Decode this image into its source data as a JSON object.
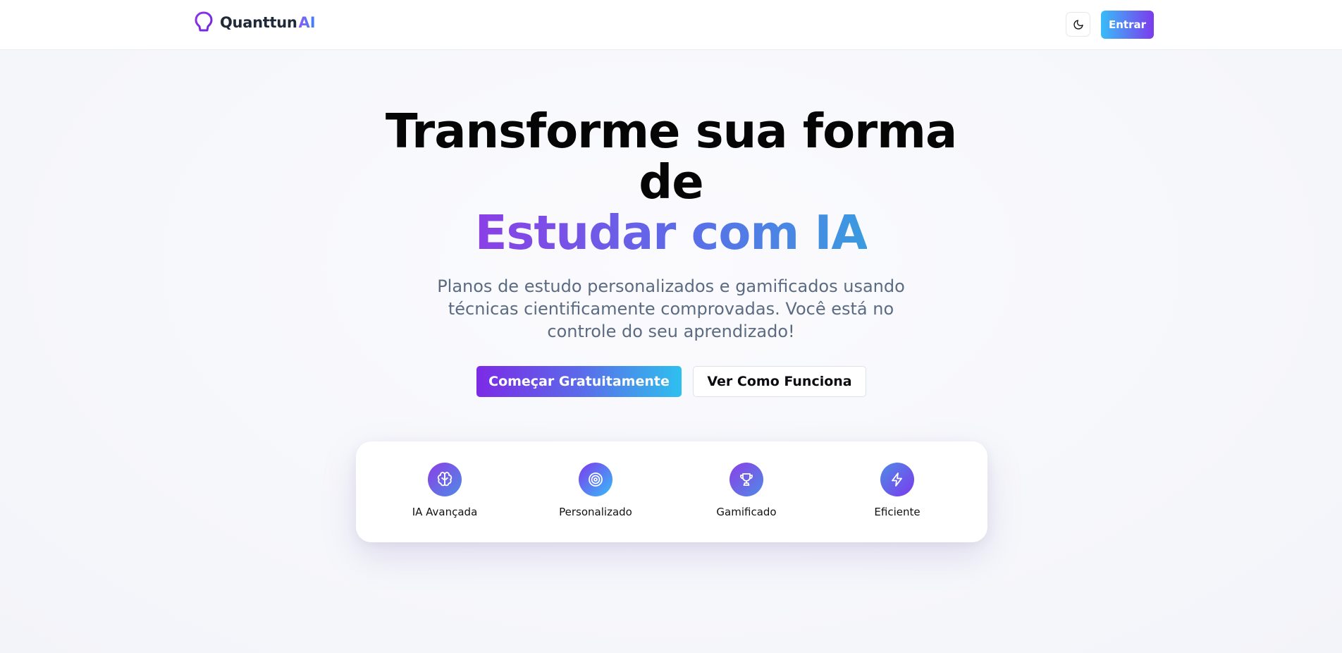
{
  "header": {
    "brand_name": "Quanttun",
    "brand_suffix": "AI",
    "enter_label": "Entrar"
  },
  "hero": {
    "title_line1": "Transforme sua forma",
    "title_line2": "de",
    "title_highlight": "Estudar com IA",
    "subtitle": "Planos de estudo personalizados e gamificados usando técnicas cientificamente comprovadas. Você está no controle do seu aprendizado!",
    "primary_cta": "Começar Gratuitamente",
    "secondary_cta": "Ver Como Funciona"
  },
  "features": [
    {
      "label": "IA Avançada",
      "icon": "brain-icon"
    },
    {
      "label": "Personalizado",
      "icon": "target-icon"
    },
    {
      "label": "Gamificado",
      "icon": "trophy-icon"
    },
    {
      "label": "Eficiente",
      "icon": "lightning-icon"
    }
  ],
  "colors": {
    "purple": "#7c3aed",
    "blue": "#3b82f6",
    "cyan": "#38bdf8",
    "text_muted": "#5b6b82"
  }
}
